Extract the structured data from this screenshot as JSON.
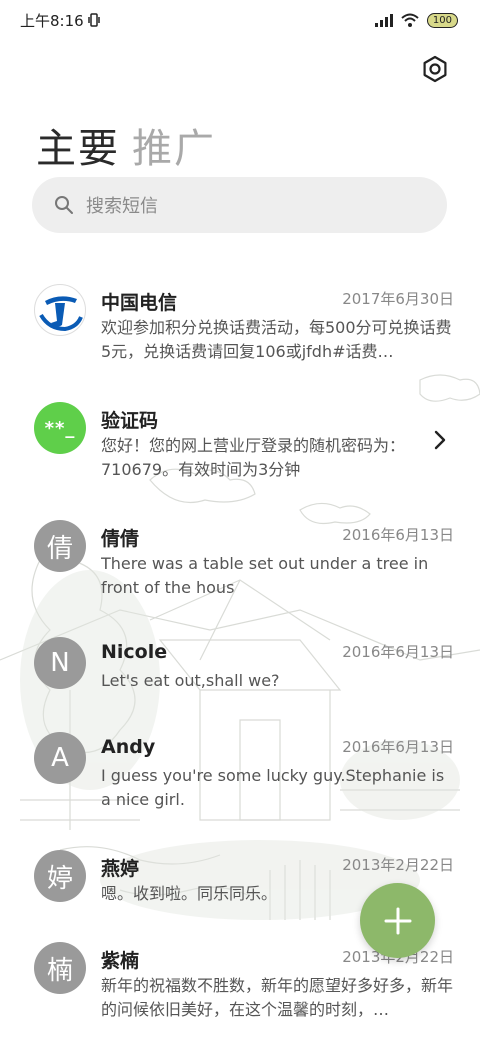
{
  "status_bar": {
    "time": "上午8:16",
    "battery": "100"
  },
  "tabs": {
    "primary": "主要",
    "promo": "推广"
  },
  "search": {
    "placeholder": "搜索短信"
  },
  "conversations": [
    {
      "name": "中国电信",
      "date": "2017年6月30日",
      "snippet": "欢迎参加积分兑换话费活动，每500分可兑换话费5元，兑换话费请回复106或jfdh#话费…",
      "avatar_type": "telecom-logo"
    },
    {
      "name": "验证码",
      "date": "",
      "snippet": "您好！您的网上营业厅登录的随机密码为：710679。有效时间为3分钟",
      "avatar_text": "**_"
    },
    {
      "name": "倩倩",
      "date": "2016年6月13日",
      "snippet": "There was a table set out under a tree in front of the hous",
      "avatar_text": "倩"
    },
    {
      "name": "Nicole",
      "date": "2016年6月13日",
      "snippet": "Let's eat out,shall we?",
      "avatar_text": "N"
    },
    {
      "name": "Andy",
      "date": "2016年6月13日",
      "snippet": "I guess you're some lucky guy.Stephanie is a nice girl.",
      "avatar_text": "A"
    },
    {
      "name": "燕婷",
      "date": "2013年2月22日",
      "snippet": "嗯。收到啦。同乐同乐。",
      "avatar_text": "婷"
    },
    {
      "name": "紫楠",
      "date": "2013年2月22日",
      "snippet": "新年的祝福数不胜数，新年的愿望好多好多，新年的问候依旧美好，在这个温馨的时刻，…",
      "avatar_text": "楠"
    }
  ],
  "colors": {
    "fab": "#8db86a",
    "avatar_gray": "#9a9a9a",
    "avatar_green": "#5fcf4a",
    "search_bg": "#eeeeee"
  },
  "icons": {
    "settings": "hexagon-gear-icon",
    "search": "search-icon",
    "chevron": "chevron-right-icon",
    "fab": "plus-icon"
  }
}
